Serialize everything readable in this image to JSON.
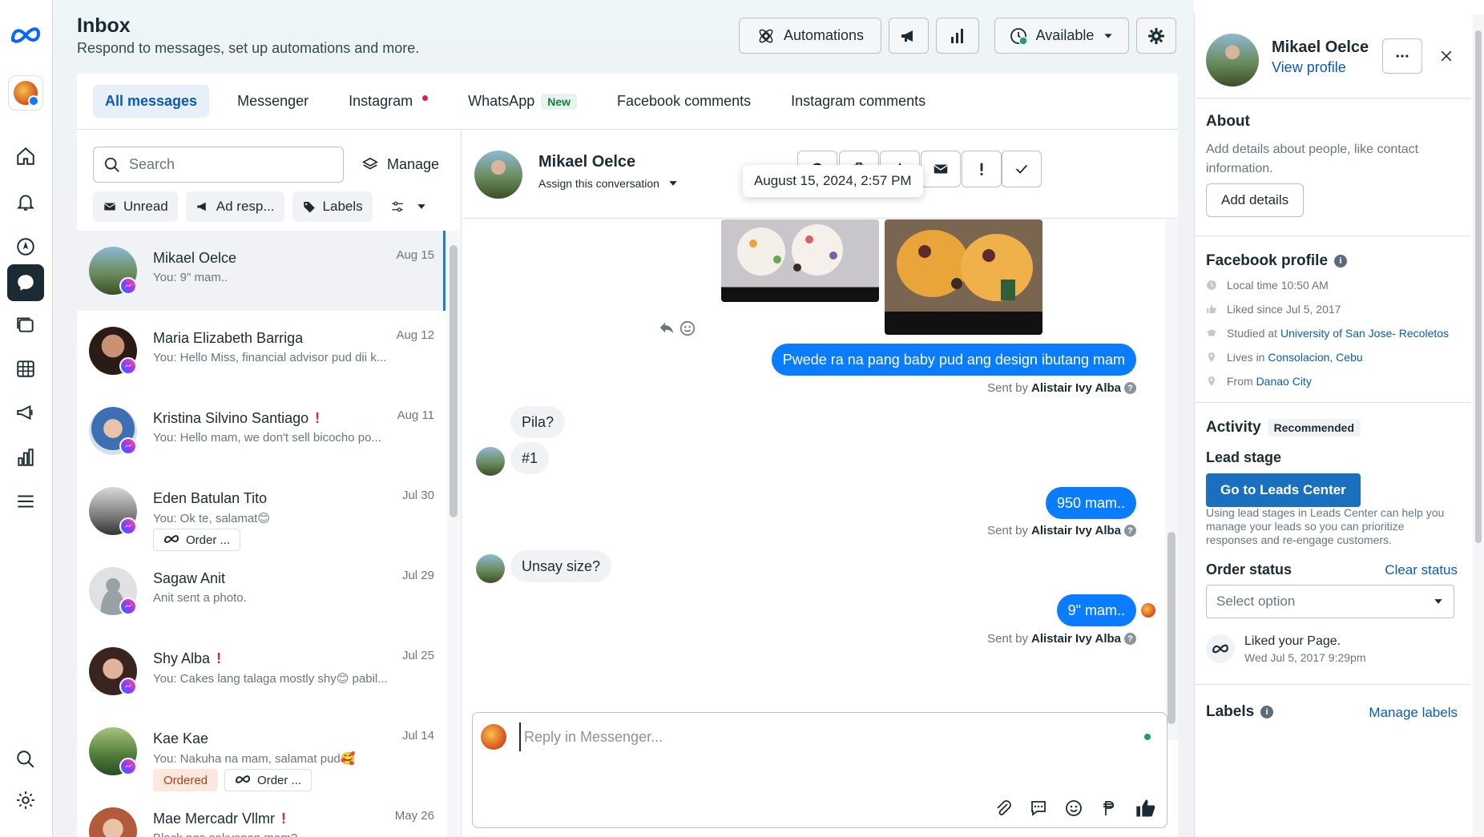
{
  "header": {
    "title": "Inbox",
    "subtitle": "Respond to messages, set up automations and more.",
    "automations_label": "Automations",
    "status_label": "Available"
  },
  "tabs": [
    {
      "label": "All messages",
      "active": true
    },
    {
      "label": "Messenger"
    },
    {
      "label": "Instagram",
      "dot": true
    },
    {
      "label": "WhatsApp",
      "badge": "New"
    },
    {
      "label": "Facebook comments"
    },
    {
      "label": "Instagram comments"
    }
  ],
  "list": {
    "search_placeholder": "Search",
    "manage_label": "Manage",
    "filters": [
      "Unread",
      "Ad resp...",
      "Labels"
    ],
    "conversations": [
      {
        "name": "Mikael Oelce",
        "preview": "You: 9\" mam..",
        "date": "Aug 15",
        "active": true,
        "important": false,
        "tags": []
      },
      {
        "name": "Maria Elizabeth Barriga",
        "preview": "You: Hello Miss, financial advisor pud dii k...",
        "date": "Aug 12",
        "important": false,
        "tags": []
      },
      {
        "name": "Kristina Silvino Santiago",
        "preview": "You: Hello mam, we don't sell bicocho po...",
        "date": "Aug 11",
        "important": true,
        "tags": []
      },
      {
        "name": "Eden Batulan Tito",
        "preview": "You: Ok te, salamat😊",
        "date": "Jul 30",
        "important": false,
        "tags": [
          {
            "label": "Order ...",
            "type": "meta"
          }
        ]
      },
      {
        "name": "Sagaw Anit",
        "preview": "Anit sent a photo.",
        "date": "Jul 29",
        "important": false,
        "tags": []
      },
      {
        "name": "Shy Alba",
        "preview": "You: Cakes lang talaga mostly shy😊 pabil...",
        "date": "Jul 25",
        "important": true,
        "tags": []
      },
      {
        "name": "Kae Kae",
        "preview": "You: Nakuha na mam, salamat pud🥰",
        "date": "Jul 14",
        "important": false,
        "tags": [
          {
            "label": "Ordered",
            "type": "ordered"
          },
          {
            "label": "Order ...",
            "type": "meta"
          }
        ]
      },
      {
        "name": "Mae Mercadr Vllmr",
        "preview": "Black nga sakyanan mam?",
        "date": "May 26",
        "important": true,
        "tags": []
      }
    ]
  },
  "chat": {
    "name": "Mikael Oelce",
    "assign_label": "Assign this conversation",
    "tooltip": "August 15, 2024, 2:57 PM",
    "messages": [
      {
        "dir": "out",
        "text": "Pwede ra na pang baby pud ang design ibutang mam",
        "sent_by_prefix": "Sent by",
        "sent_by": "Alistair Ivy Alba"
      },
      {
        "dir": "in",
        "text": "Pila?"
      },
      {
        "dir": "in",
        "text": "#1"
      },
      {
        "dir": "out",
        "text": "950 mam..",
        "sent_by_prefix": "Sent by",
        "sent_by": "Alistair Ivy Alba"
      },
      {
        "dir": "in",
        "text": "Unsay size?"
      },
      {
        "dir": "out",
        "text": "9\" mam..",
        "sent_by_prefix": "Sent by",
        "sent_by": "Alistair Ivy Alba"
      }
    ],
    "reply_placeholder": "Reply in Messenger..."
  },
  "profile": {
    "name": "Mikael Oelce",
    "view_profile": "View profile",
    "about_title": "About",
    "about_text": "Add details about people, like contact information.",
    "add_details": "Add details",
    "fb_title": "Facebook profile",
    "local_time": "Local time 10:50 AM",
    "liked_since": "Liked since Jul 5, 2017",
    "studied_prefix": "Studied at",
    "studied_at": "University of San Jose- Recoletos",
    "lives_prefix": "Lives in",
    "lives_in": "Consolacion, Cebu",
    "from_prefix": "From",
    "from": "Danao City",
    "activity_title": "Activity",
    "recommended": "Recommended",
    "lead_stage": "Lead stage",
    "leads_button": "Go to Leads Center",
    "leads_text": "Using lead stages in Leads Center can help you manage your leads so you can prioritize responses and re-engage customers.",
    "order_status": "Order status",
    "clear_status": "Clear status",
    "select_option": "Select option",
    "liked_page": "Liked your Page.",
    "liked_page_date": "Wed Jul 5, 2017 9:29pm",
    "labels_title": "Labels",
    "manage_labels": "Manage labels"
  }
}
